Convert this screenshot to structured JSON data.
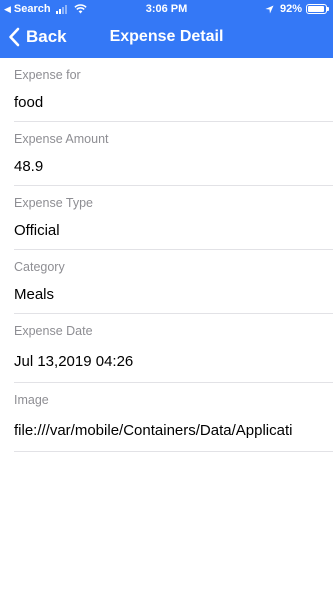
{
  "status_bar": {
    "back_app": "Search",
    "time": "3:06 PM",
    "battery": "92%",
    "battery_level": 0.92
  },
  "nav": {
    "back_label": "Back",
    "title": "Expense Detail",
    "accent_color": "#3478f6"
  },
  "fields": [
    {
      "label": "Expense for",
      "value": "food"
    },
    {
      "label": "Expense Amount",
      "value": "48.9"
    },
    {
      "label": "Expense Type",
      "value": "Official"
    },
    {
      "label": "Category",
      "value": "Meals"
    },
    {
      "label": "Expense Date",
      "value": "Jul 13,2019 04:26"
    },
    {
      "label": "Image",
      "value": "file:///var/mobile/Containers/Data/Applicati"
    }
  ]
}
